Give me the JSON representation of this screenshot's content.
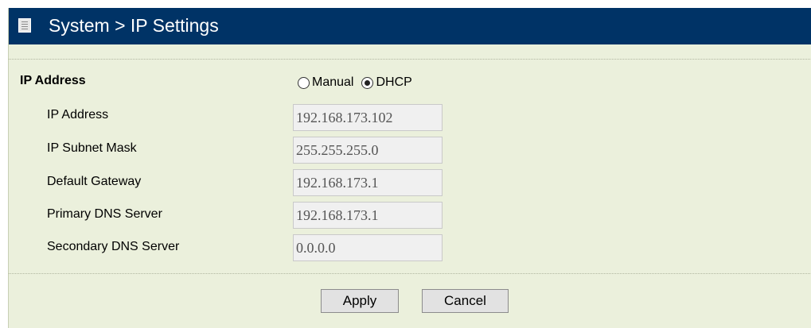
{
  "header": {
    "title": "System > IP Settings",
    "icon": "list-icon"
  },
  "ip_address_section": {
    "label": "IP Address",
    "mode_options": [
      {
        "label": "Manual",
        "selected": false
      },
      {
        "label": "DHCP",
        "selected": true
      }
    ]
  },
  "fields": [
    {
      "label": "IP Address",
      "value": "192.168.173.102"
    },
    {
      "label": "IP Subnet Mask",
      "value": "255.255.255.0"
    },
    {
      "label": "Default Gateway",
      "value": "192.168.173.1"
    },
    {
      "label": "Primary DNS Server",
      "value": "192.168.173.1"
    },
    {
      "label": "Secondary DNS Server",
      "value": "0.0.0.0"
    }
  ],
  "actions": {
    "apply_label": "Apply",
    "cancel_label": "Cancel"
  },
  "colors": {
    "header_bg": "#003366",
    "panel_bg": "#ebf0dc",
    "field_bg": "#f0f0f0"
  }
}
